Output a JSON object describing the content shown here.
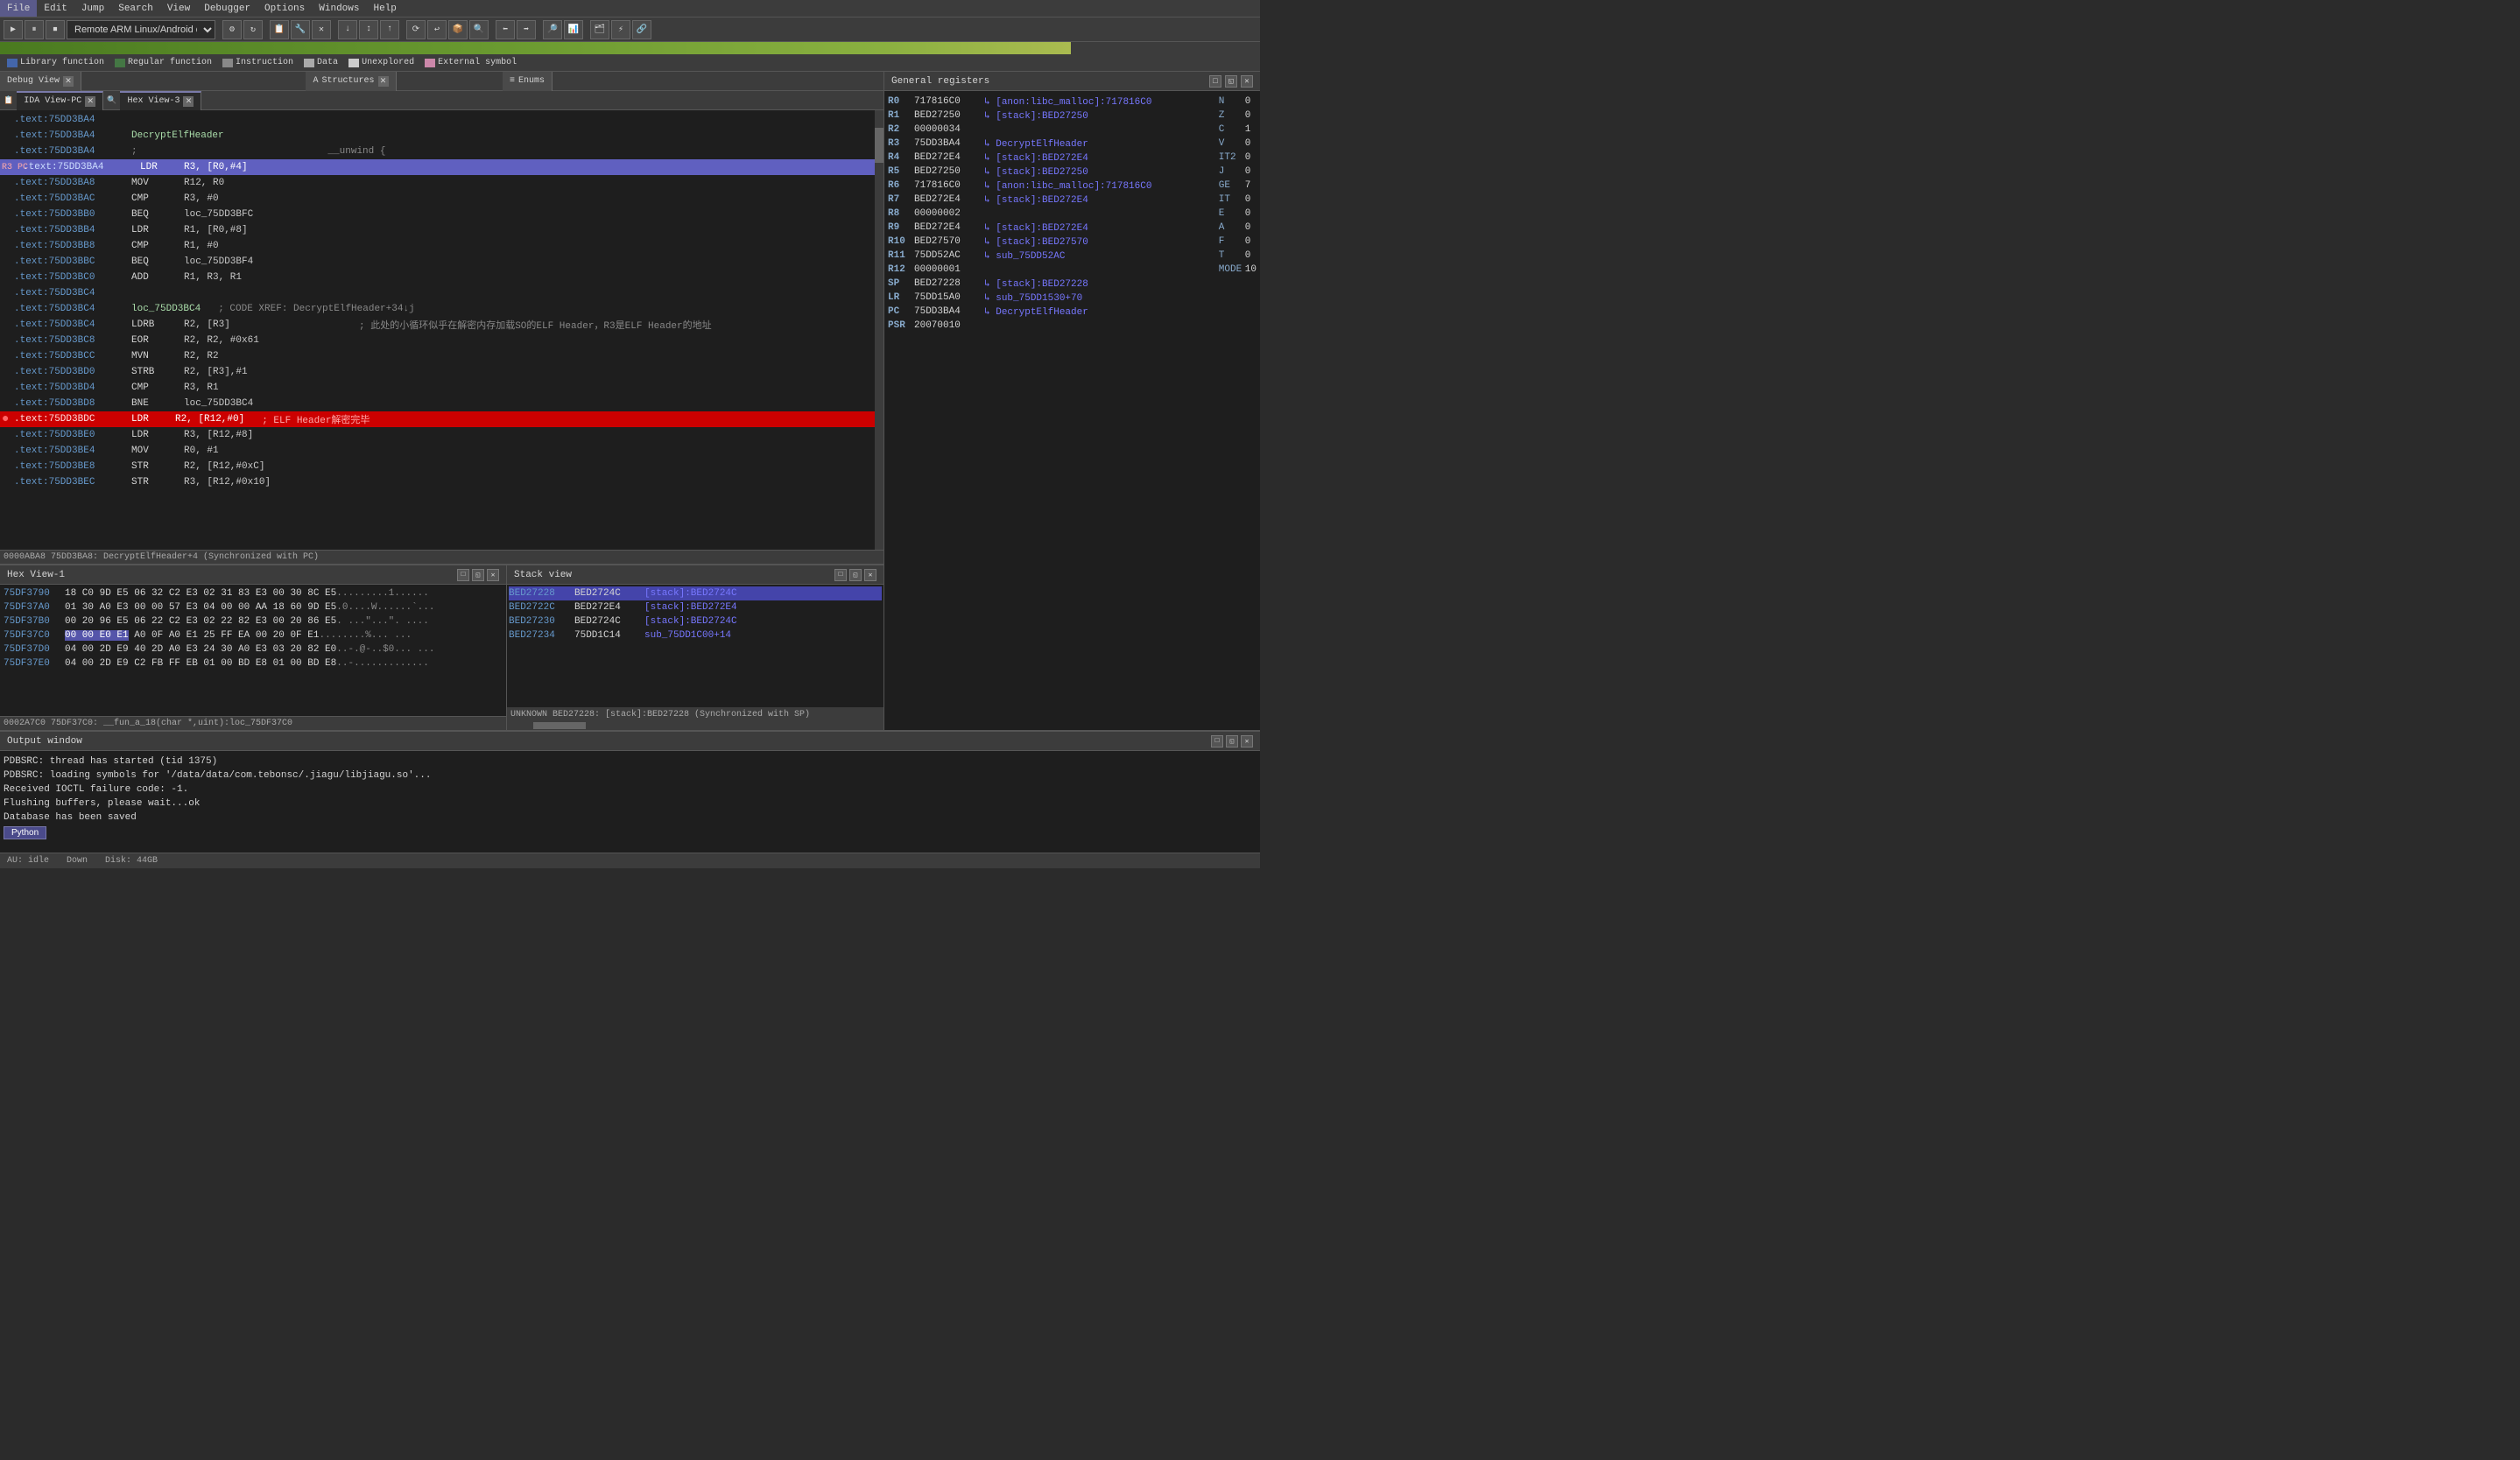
{
  "menuBar": {
    "items": [
      "File",
      "Edit",
      "Jump",
      "Search",
      "View",
      "Debugger",
      "Options",
      "Windows",
      "Help"
    ]
  },
  "toolbar": {
    "debuggerDropdown": "Remote ARM Linux/Android debugger",
    "searchLabel": "Search"
  },
  "legend": {
    "items": [
      {
        "label": "Library function",
        "color": "#4466aa"
      },
      {
        "label": "Regular function",
        "color": "#447744"
      },
      {
        "label": "Instruction",
        "color": "#888888"
      },
      {
        "label": "Data",
        "color": "#aaaaaa"
      },
      {
        "label": "Unexplored",
        "color": "#cccccc"
      },
      {
        "label": "External symbol",
        "color": "#cc88aa"
      }
    ]
  },
  "tabs": {
    "debugView": {
      "label": "Debug View",
      "active": false
    },
    "structures": {
      "label": "Structures",
      "active": false
    },
    "enums": {
      "label": "Enums",
      "active": false
    },
    "idaViewPC": {
      "label": "IDA View-PC",
      "active": true
    },
    "hexView3": {
      "label": "Hex View-3",
      "active": true
    }
  },
  "codeLines": [
    {
      "addr": ".text:75DD3BA4",
      "mnemonic": "",
      "operands": "",
      "comment": "",
      "type": "normal"
    },
    {
      "addr": ".text:75DD3BA4",
      "mnemonic": "DecryptElfHeader",
      "operands": "",
      "comment": "",
      "type": "label"
    },
    {
      "addr": ".text:75DD3BA4",
      "mnemonic": ";",
      "operands": "__unwind {",
      "comment": "",
      "type": "comment-line"
    },
    {
      "addr": ".text:75DD3BA4",
      "mnemonic": "LDR",
      "operands": "R3, [R0,#4]",
      "comment": "",
      "type": "highlighted",
      "marker": "R3/PC"
    },
    {
      "addr": ".text:75DD3BA8",
      "mnemonic": "MOV",
      "operands": "R12, R0",
      "comment": "",
      "type": "normal"
    },
    {
      "addr": ".text:75DD3BAC",
      "mnemonic": "CMP",
      "operands": "R3, #0",
      "comment": "",
      "type": "normal"
    },
    {
      "addr": ".text:75DD3BB0",
      "mnemonic": "BEQ",
      "operands": "loc_75DD3BFC",
      "comment": "",
      "type": "normal"
    },
    {
      "addr": ".text:75DD3BB4",
      "mnemonic": "LDR",
      "operands": "R1, [R0,#8]",
      "comment": "",
      "type": "normal"
    },
    {
      "addr": ".text:75DD3BB8",
      "mnemonic": "CMP",
      "operands": "R1, #0",
      "comment": "",
      "type": "normal"
    },
    {
      "addr": ".text:75DD3BBC",
      "mnemonic": "BEQ",
      "operands": "loc_75DD3BF4",
      "comment": "",
      "type": "normal"
    },
    {
      "addr": ".text:75DD3BC0",
      "mnemonic": "ADD",
      "operands": "R1, R3, R1",
      "comment": "",
      "type": "normal"
    },
    {
      "addr": ".text:75DD3BC4",
      "mnemonic": "",
      "operands": "",
      "comment": "",
      "type": "normal"
    },
    {
      "addr": ".text:75DD3BC4",
      "mnemonic": "loc_75DD3BC4",
      "operands": "",
      "comment": "; CODE XREF: DecryptElfHeader+34↓j",
      "type": "label-comment"
    },
    {
      "addr": ".text:75DD3BC4",
      "mnemonic": "LDRB",
      "operands": "R2, [R3]",
      "comment": "; 此处的小循环似乎在解密内存加载SO的ELF Header，R3是ELF Header的地址",
      "type": "normal"
    },
    {
      "addr": ".text:75DD3BC8",
      "mnemonic": "EOR",
      "operands": "R2, R2, #0x61",
      "comment": "",
      "type": "normal"
    },
    {
      "addr": ".text:75DD3BCC",
      "mnemonic": "MVN",
      "operands": "R2, R2",
      "comment": "",
      "type": "normal"
    },
    {
      "addr": ".text:75DD3BD0",
      "mnemonic": "STRB",
      "operands": "R2, [R3],#1",
      "comment": "",
      "type": "normal"
    },
    {
      "addr": ".text:75DD3BD4",
      "mnemonic": "CMP",
      "operands": "R3, R1",
      "comment": "",
      "type": "normal"
    },
    {
      "addr": ".text:75DD3BD8",
      "mnemonic": "BNE",
      "operands": "loc_75DD3BC4",
      "comment": "",
      "type": "normal"
    },
    {
      "addr": ".text:75DD3BDC",
      "mnemonic": "LDR",
      "operands": "R2, [R12,#0]",
      "comment": "; ELF Header解密完毕",
      "type": "red",
      "breakpoint": true
    },
    {
      "addr": ".text:75DD3BE0",
      "mnemonic": "LDR",
      "operands": "R3, [R12,#8]",
      "comment": "",
      "type": "normal"
    },
    {
      "addr": ".text:75DD3BE4",
      "mnemonic": "MOV",
      "operands": "R0, #1",
      "comment": "",
      "type": "normal"
    },
    {
      "addr": ".text:75DD3BE8",
      "mnemonic": "STR",
      "operands": "R2, [R12,#0xC]",
      "comment": "",
      "type": "normal"
    },
    {
      "addr": ".text:75DD3BEC",
      "mnemonic": "STR",
      "operands": "R3, [R12,#0x10]",
      "comment": "",
      "type": "normal"
    }
  ],
  "codeStatus": "0000ABA8 75DD3BA8: DecryptElfHeader+4 (Synchronized with PC)",
  "registers": {
    "title": "General registers",
    "regs": [
      {
        "name": "R0",
        "value": "717816C0",
        "ref": "↳ [anon:libc_malloc]:717816C0"
      },
      {
        "name": "R1",
        "value": "BED27250",
        "ref": "↳ [stack]:BED27250"
      },
      {
        "name": "R2",
        "value": "00000034",
        "ref": ""
      },
      {
        "name": "R3",
        "value": "75DD3BA4",
        "ref": "↳ DecryptElfHeader"
      },
      {
        "name": "R4",
        "value": "BED272E4",
        "ref": "↳ [stack]:BED272E4"
      },
      {
        "name": "R5",
        "value": "BED27250",
        "ref": "↳ [stack]:BED27250"
      },
      {
        "name": "R6",
        "value": "717816C0",
        "ref": "↳ [anon:libc_malloc]:717816C0"
      },
      {
        "name": "R7",
        "value": "BED272E4",
        "ref": "↳ [stack]:BED272E4"
      },
      {
        "name": "R8",
        "value": "00000002",
        "ref": ""
      },
      {
        "name": "R9",
        "value": "BED272E4",
        "ref": "↳ [stack]:BED272E4"
      },
      {
        "name": "R10",
        "value": "BED27570",
        "ref": "↳ [stack]:BED27570"
      },
      {
        "name": "R11",
        "value": "75DD52AC",
        "ref": "↳ sub_75DD52AC"
      },
      {
        "name": "R12",
        "value": "00000001",
        "ref": ""
      },
      {
        "name": "SP",
        "value": "BED27228",
        "ref": "↳ [stack]:BED27228"
      },
      {
        "name": "LR",
        "value": "75DD15A0",
        "ref": "↳ sub_75DD1530+70"
      },
      {
        "name": "PC",
        "value": "75DD3BA4",
        "ref": "↳ DecryptElfHeader"
      },
      {
        "name": "PSR",
        "value": "20070010",
        "ref": ""
      }
    ],
    "flags": [
      {
        "name": "N",
        "value": "0"
      },
      {
        "name": "Z",
        "value": "0"
      },
      {
        "name": "C",
        "value": "1"
      },
      {
        "name": "V",
        "value": "0"
      },
      {
        "name": "IT2",
        "value": "0"
      },
      {
        "name": "J",
        "value": "0"
      },
      {
        "name": "GE",
        "value": "7"
      },
      {
        "name": "IT",
        "value": "0"
      },
      {
        "name": "E",
        "value": "0"
      },
      {
        "name": "A",
        "value": "0"
      },
      {
        "name": "F",
        "value": "0"
      },
      {
        "name": "T",
        "value": "0"
      },
      {
        "name": "MODE",
        "value": "10"
      }
    ]
  },
  "hexView1": {
    "title": "Hex View-1",
    "lines": [
      {
        "addr": "75DF3790",
        "bytes": "18 C0 9D E5 06 32 C2 E3 02 31 83 E3 00 30 8C E5",
        "ascii": "..........1......"
      },
      {
        "addr": "75DF37A0",
        "bytes": "01 30 A0 E3 00 00 57 E3 04 00 00 AA 18 60 9D E5",
        "ascii": ".0....W......`..."
      },
      {
        "addr": "75DF37B0",
        "bytes": "00 20 96 E5 06 22 C2 E3 02 22 82 E3 00 20 86 E5",
        "ascii": ". ...\"...\"... ..."
      },
      {
        "addr": "75DF37C0",
        "bytes": "00 00 E0 E1 A0 0F A0 E1 25 FF EA 00 20 0F E1",
        "ascii": "........%... ...",
        "highlight": true
      },
      {
        "addr": "75DF37D0",
        "bytes": "04 00 2D E9 40 2D A0 E3 24 30 A0 E3 03 20 82 E0",
        "ascii": "..-.@-..$0... ..."
      },
      {
        "addr": "75DF37E0",
        "bytes": "04 00 2D E9 C2 FB FF EB 01 00 BD E8 01 00 BD E8",
        "ascii": "..-.............."
      }
    ],
    "status": "0002A7C0 75DF37C0: __fun_a_18(char *,uint):loc_75DF37C0"
  },
  "stackView": {
    "title": "Stack view",
    "rows": [
      {
        "addr": "BED27228",
        "val": "BED2724C",
        "ref": "[stack]:BED2724C",
        "highlighted": true
      },
      {
        "addr": "BED2722C",
        "val": "BED272E4",
        "ref": "[stack]:BED272E4",
        "highlighted": false
      },
      {
        "addr": "BED27230",
        "val": "BED2724C",
        "ref": "[stack]:BED2724C",
        "highlighted": false
      },
      {
        "addr": "BED27234",
        "val": "75DD1C14",
        "ref": "sub_75DD1C00+14",
        "highlighted": false
      }
    ],
    "status": "UNKNOWN BED27228: [stack]:BED27228 (Synchronized with SP)"
  },
  "outputWindow": {
    "title": "Output window",
    "lines": [
      "PDBSRC: thread has started (tid 1375)",
      "PDBSRC: loading symbols for '/data/data/com.tebonsc/.jiagu/libjiagu.so'...",
      "Received IOCTL failure code: -1.",
      "Flushing buffers, please wait...ok",
      "Database has been saved"
    ],
    "pythonBtn": "Python"
  },
  "statusBar": {
    "au": "AU: idle",
    "down": "Down",
    "disk": "Disk: 44GB"
  }
}
